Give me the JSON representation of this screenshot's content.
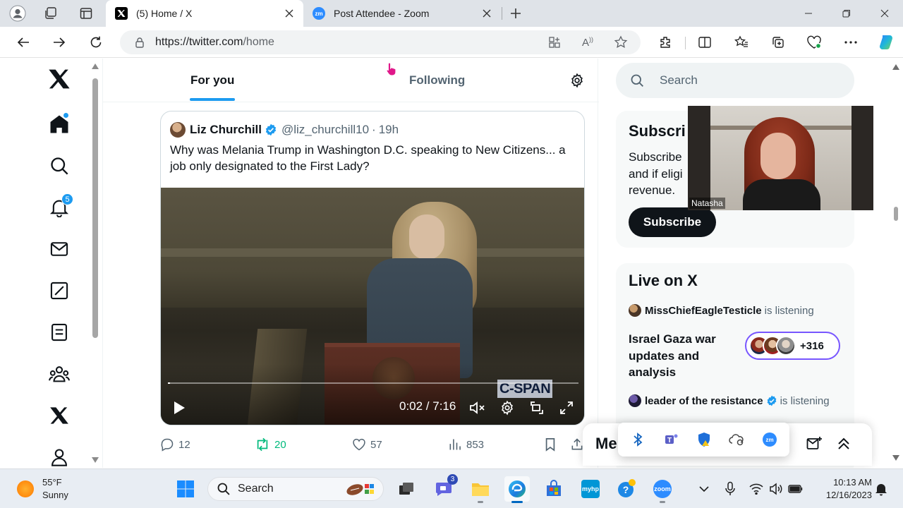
{
  "browser": {
    "tabs": [
      {
        "title": "(5) Home / X",
        "favicon": "x-logo-icon",
        "active": true
      },
      {
        "title": "Post Attendee - Zoom",
        "favicon": "zoom-icon",
        "active": false
      }
    ],
    "url_host": "https://twitter.com",
    "url_path": "/home"
  },
  "x": {
    "nav": {
      "notifications_badge": "5",
      "items": [
        "home-icon",
        "search-icon",
        "notifications-icon",
        "messages-icon",
        "grok-icon",
        "lists-icon",
        "communities-icon",
        "premium-icon",
        "profile-icon"
      ]
    },
    "timeline_tabs": {
      "for_you": "For you",
      "following": "Following"
    },
    "quote": {
      "name": "Liz Churchill",
      "handle": "@liz_churchill10",
      "sep": "·",
      "time": "19h",
      "text": "Why was Melania Trump in Washington D.C. speaking to New Citizens... a job only designated to the First Lady?",
      "video": {
        "watermark": "C-SPAN",
        "time": "0:02 / 7:16",
        "progress": 0.005
      }
    },
    "actions": {
      "replies": "12",
      "reposts": "20",
      "likes": "57",
      "views": "853"
    },
    "search_placeholder": "Search",
    "subscribe": {
      "heading": "Subscri",
      "desc": "Subscribe\nand if eligi\nrevenue.",
      "button": "Subscribe"
    },
    "live": {
      "heading": "Live on X",
      "space1": {
        "host": "MissChiefEagleTesticle",
        "status": "is listening",
        "title": "Israel Gaza war updates and analysis",
        "count": "+316"
      },
      "space2": {
        "host": "leader of the resistance",
        "status": "is listening"
      }
    },
    "messages_label": "Me"
  },
  "zoom": {
    "participant_name": "Natasha"
  },
  "taskbar": {
    "weather_temp": "55°F",
    "weather_cond": "Sunny",
    "search_placeholder": "Search",
    "chat_badge": "3",
    "time": "10:13 AM",
    "date": "12/16/2023"
  },
  "colors": {
    "x_blue": "#1d9bf0",
    "repost_green": "#00ba7c",
    "space_purple": "#7856ff"
  }
}
